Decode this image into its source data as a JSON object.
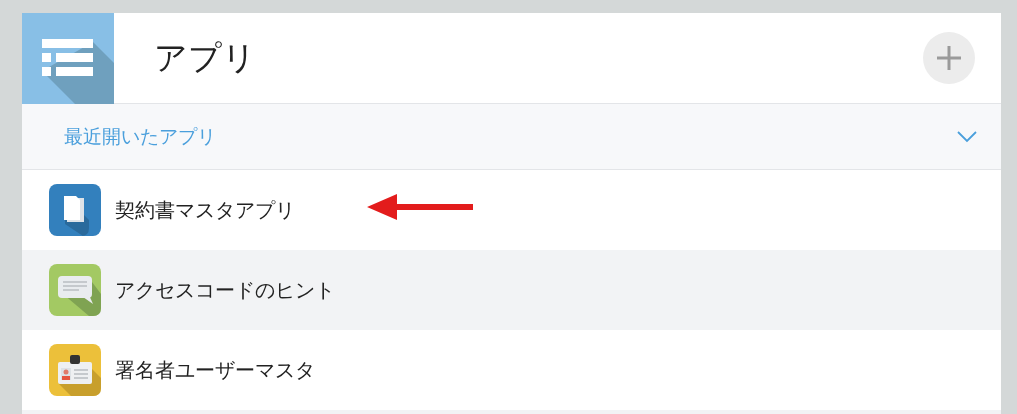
{
  "header": {
    "title": "アプリ"
  },
  "section": {
    "label": "最近開いたアプリ",
    "expanded": true
  },
  "apps": [
    {
      "name": "契約書マスタアプリ",
      "kind": "document",
      "highlighted": false,
      "pointed": true
    },
    {
      "name": "アクセスコードのヒント",
      "kind": "chat",
      "highlighted": true,
      "pointed": false
    },
    {
      "name": "署名者ユーザーマスタ",
      "kind": "badge",
      "highlighted": false,
      "pointed": false
    }
  ]
}
